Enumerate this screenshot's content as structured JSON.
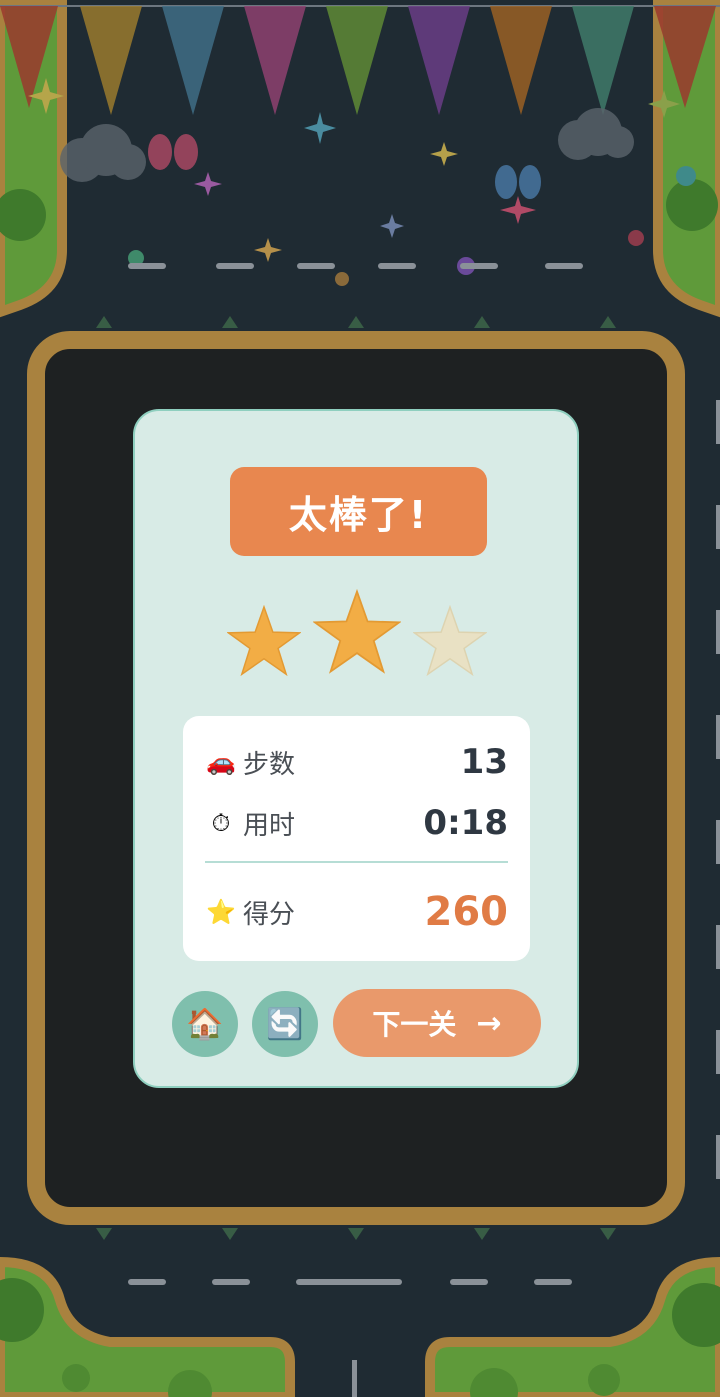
{
  "result": {
    "title": "太棒了!",
    "stars_earned": 2,
    "stars_total": 3
  },
  "stats": {
    "steps": {
      "icon": "car-icon",
      "glyph": "🚗",
      "label": "步数",
      "value": "13"
    },
    "time": {
      "icon": "stopwatch-icon",
      "glyph": "⏱",
      "label": "用时",
      "value": "0:18"
    },
    "score": {
      "icon": "star-icon",
      "glyph": "⭐",
      "label": "得分",
      "value": "260"
    }
  },
  "buttons": {
    "home": {
      "icon": "house-icon",
      "glyph": "🏠"
    },
    "restart": {
      "icon": "restart-icon",
      "glyph": "🔄"
    },
    "next": {
      "label": "下一关",
      "arrow": "→"
    }
  },
  "colors": {
    "banner": "#e8874f",
    "star_filled": "#f2ad45",
    "star_empty": "#e9e1c4",
    "score": "#e07b45",
    "card_bg": "#d8ebe6"
  }
}
